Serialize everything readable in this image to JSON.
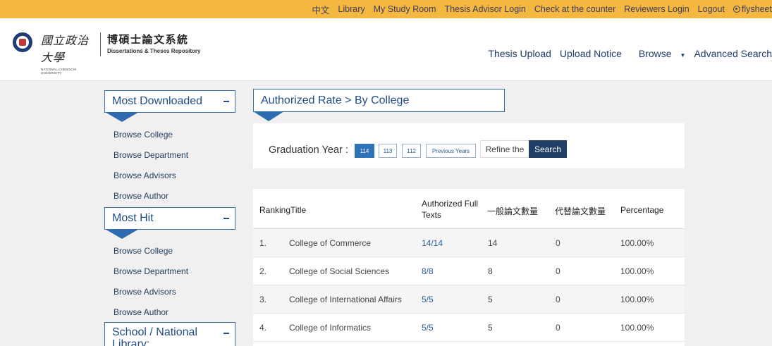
{
  "topbar": {
    "links": [
      "中文",
      "Library",
      "My Study Room",
      "Thesis Advisor Login",
      "Check at the counter",
      "Reviewers Login",
      "Logout"
    ],
    "user": "flysheet"
  },
  "header": {
    "univ_cn": "國立政治大學",
    "univ_en": "NATIONAL CHENGCHI UNIVERSITY",
    "repo_cn": "博碩士論文系統",
    "repo_en": "Dissertations & Theses Repository",
    "nav": {
      "upload": "Thesis Upload",
      "notice": "Upload Notice",
      "browse": "Browse",
      "advanced": "Advanced Search"
    }
  },
  "sidebar": {
    "sections": [
      {
        "title": "Most Downloaded",
        "links": [
          "Browse College",
          "Browse Department",
          "Browse Advisors",
          "Browse Author"
        ]
      },
      {
        "title": "Most Hit",
        "links": [
          "Browse College",
          "Browse Department",
          "Browse Advisors",
          "Browse Author"
        ]
      },
      {
        "title": "School / National Library: Authorization"
      }
    ]
  },
  "main": {
    "title": "Authorized Rate > By College",
    "filter": {
      "label": "Graduation Year :",
      "years": [
        "114",
        "113",
        "112",
        "Previous Years"
      ],
      "active_year": "114",
      "refine": "Refine the",
      "search": "Search"
    },
    "table": {
      "headers": {
        "ranking": "Ranking",
        "title": "Title",
        "authorized_1": "Authorized Full",
        "authorized_2": "Texts",
        "general": "一般論文數量",
        "substitute": "代替論文數量",
        "percentage": "Percentage"
      },
      "rows": [
        {
          "rank": "1.",
          "title": "College of Commerce",
          "authorized": "14/14",
          "general": "14",
          "substitute": "0",
          "percentage": "100.00%"
        },
        {
          "rank": "2.",
          "title": "College of Social Sciences",
          "authorized": "8/8",
          "general": "8",
          "substitute": "0",
          "percentage": "100.00%"
        },
        {
          "rank": "3.",
          "title": "College of International Affairs",
          "authorized": "5/5",
          "general": "5",
          "substitute": "0",
          "percentage": "100.00%"
        },
        {
          "rank": "4.",
          "title": "College of Informatics",
          "authorized": "5/5",
          "general": "5",
          "substitute": "0",
          "percentage": "100.00%"
        }
      ]
    }
  },
  "colors": {
    "topbar": "#f4b73f",
    "accent": "#2e72b8",
    "navy": "#1f3f66"
  }
}
